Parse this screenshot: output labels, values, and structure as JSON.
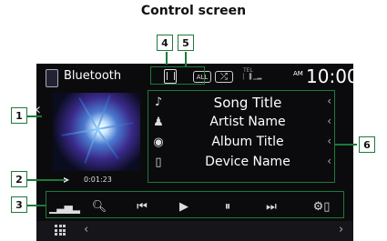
{
  "caption": "Control screen",
  "topbar": {
    "source": "Bluetooth",
    "repeat_label": "ALL",
    "shuffle_label": "⤮",
    "tel_label": "TEL",
    "signal_label": "▏▐ ▁▂",
    "ampm": "AM",
    "clock": "10:00"
  },
  "progress": {
    "time": "0:01:23"
  },
  "info_rows": [
    {
      "icon": "music-note-icon",
      "glyph": "♪",
      "text": "Song Title"
    },
    {
      "icon": "artist-icon",
      "glyph": "♟",
      "text": "Artist Name"
    },
    {
      "icon": "album-icon",
      "glyph": "◉",
      "text": "Album Title"
    },
    {
      "icon": "device-icon",
      "glyph": "▯",
      "text": "Device Name"
    }
  ],
  "callouts": [
    "1",
    "2",
    "3",
    "4",
    "5",
    "6"
  ],
  "colors": {
    "screen_bg": "#0b0b0d",
    "callout_border": "#1c7a3a"
  }
}
